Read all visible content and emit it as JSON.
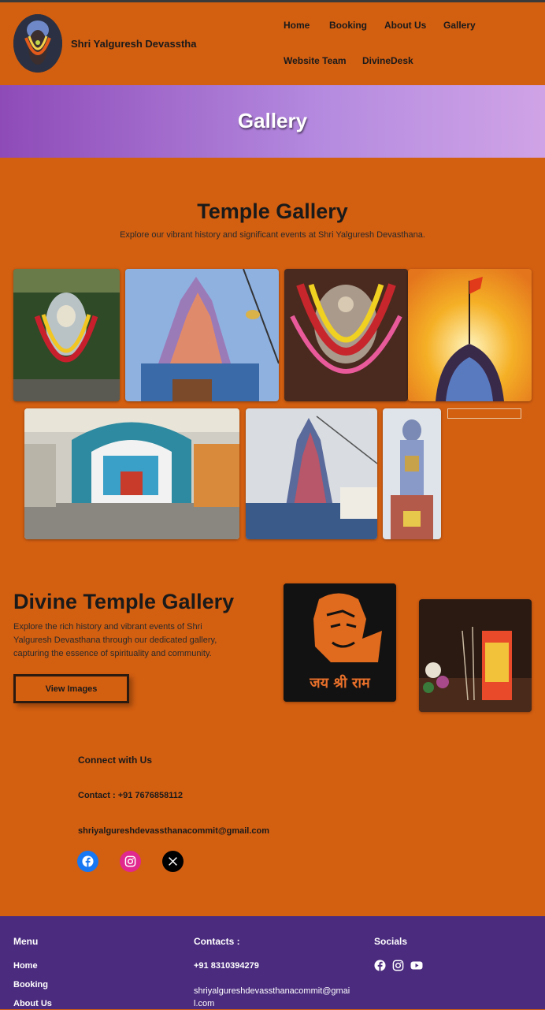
{
  "header": {
    "site_title": "Shri Yalguresh Devasstha",
    "nav": [
      "Home",
      "Booking",
      "About Us",
      "Gallery",
      "Website Team",
      "DivineDesk"
    ]
  },
  "banner": {
    "title": "Gallery"
  },
  "temple_gallery": {
    "title": "Temple Gallery",
    "subtitle": "Explore our vibrant history and significant events at Shri Yalguresh Devasthana."
  },
  "divine_gallery": {
    "title": "Divine Temple Gallery",
    "description": "Explore the rich history and vibrant events of Shri Yalguresh Devasthana through our dedicated gallery, capturing the essence of spirituality and community.",
    "button_label": "View Images",
    "poster_text": "जय श्री राम"
  },
  "connect": {
    "title": "Connect with Us",
    "contact": "Contact : +91 7676858112",
    "email": "shriyalgureshdevassthanacommit@gmail.com",
    "icons": [
      "facebook-icon",
      "instagram-icon",
      "x-icon"
    ]
  },
  "footer": {
    "menu_title": "Menu",
    "menu_items": [
      "Home",
      "Booking",
      "About Us"
    ],
    "contacts_title": "Contacts :",
    "phone": "+91 8310394279",
    "email": "shriyalgureshdevassthanacommit@gmail.com",
    "socials_title": "Socials",
    "social_icons": [
      "facebook-icon",
      "instagram-icon",
      "youtube-icon"
    ]
  },
  "colors": {
    "page_bg": "#d35f11",
    "footer_bg": "#4a2b7e",
    "banner_gradient": [
      "#8e4bb8",
      "#d0a3e6"
    ]
  }
}
